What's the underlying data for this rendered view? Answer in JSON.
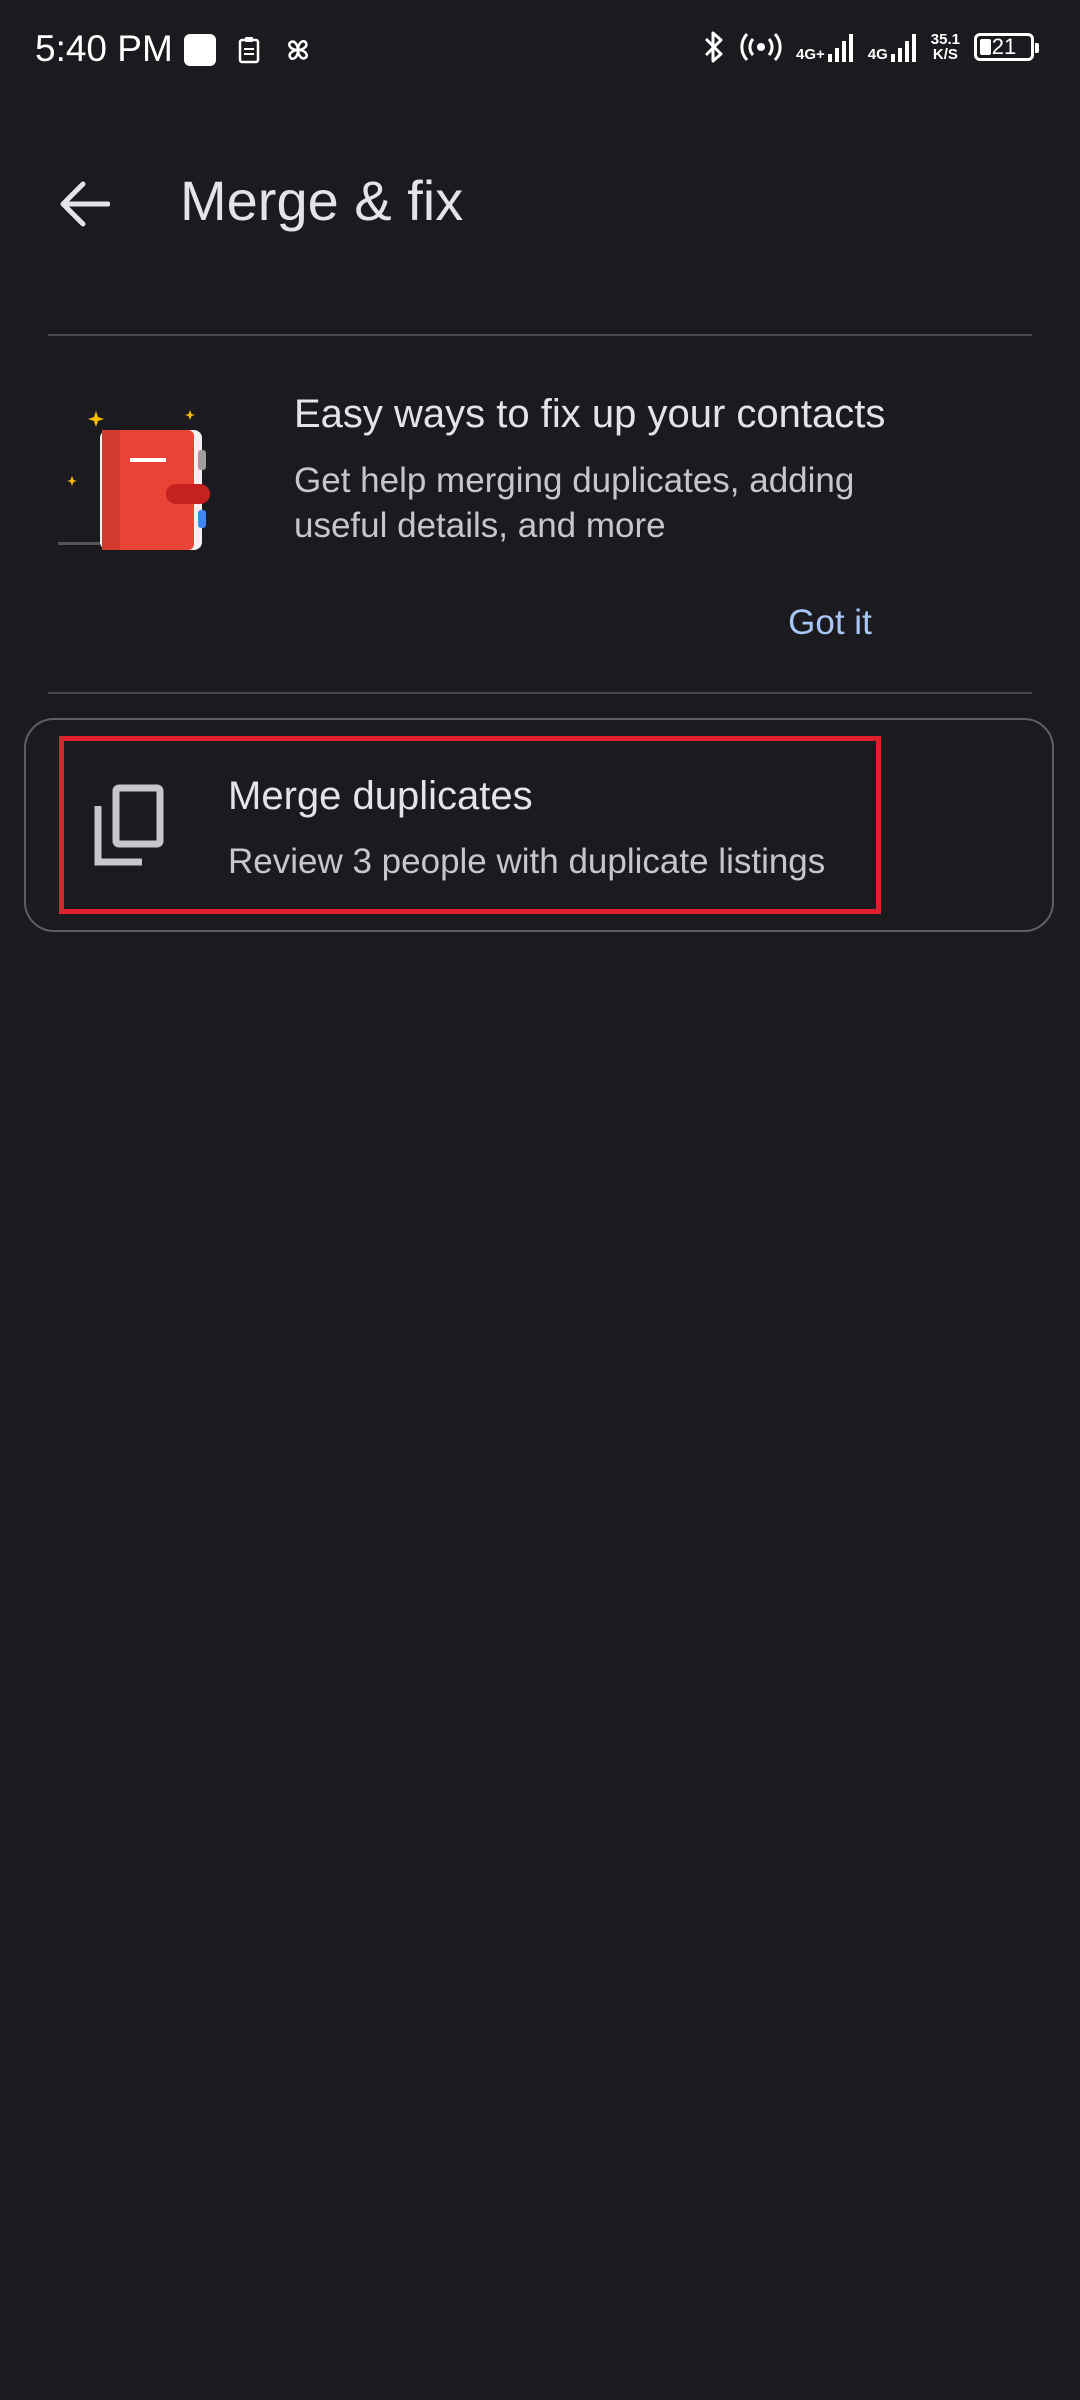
{
  "status_bar": {
    "time": "5:40 PM",
    "network_1": "4G+",
    "network_2": "4G",
    "speed_value": "35.1",
    "speed_unit": "K/S",
    "battery_level": "21"
  },
  "app_bar": {
    "title": "Merge & fix"
  },
  "promo": {
    "title": "Easy ways to fix up your contacts",
    "body": "Get help merging duplicates, adding useful details, and more",
    "action_label": "Got it"
  },
  "merge_card": {
    "title": "Merge duplicates",
    "subtitle": "Review 3 people with duplicate listings"
  },
  "colors": {
    "background": "#1b1b1f",
    "accent_link": "#a7c7fa",
    "highlight": "#e0202f",
    "notebook_red": "#ea4335"
  }
}
